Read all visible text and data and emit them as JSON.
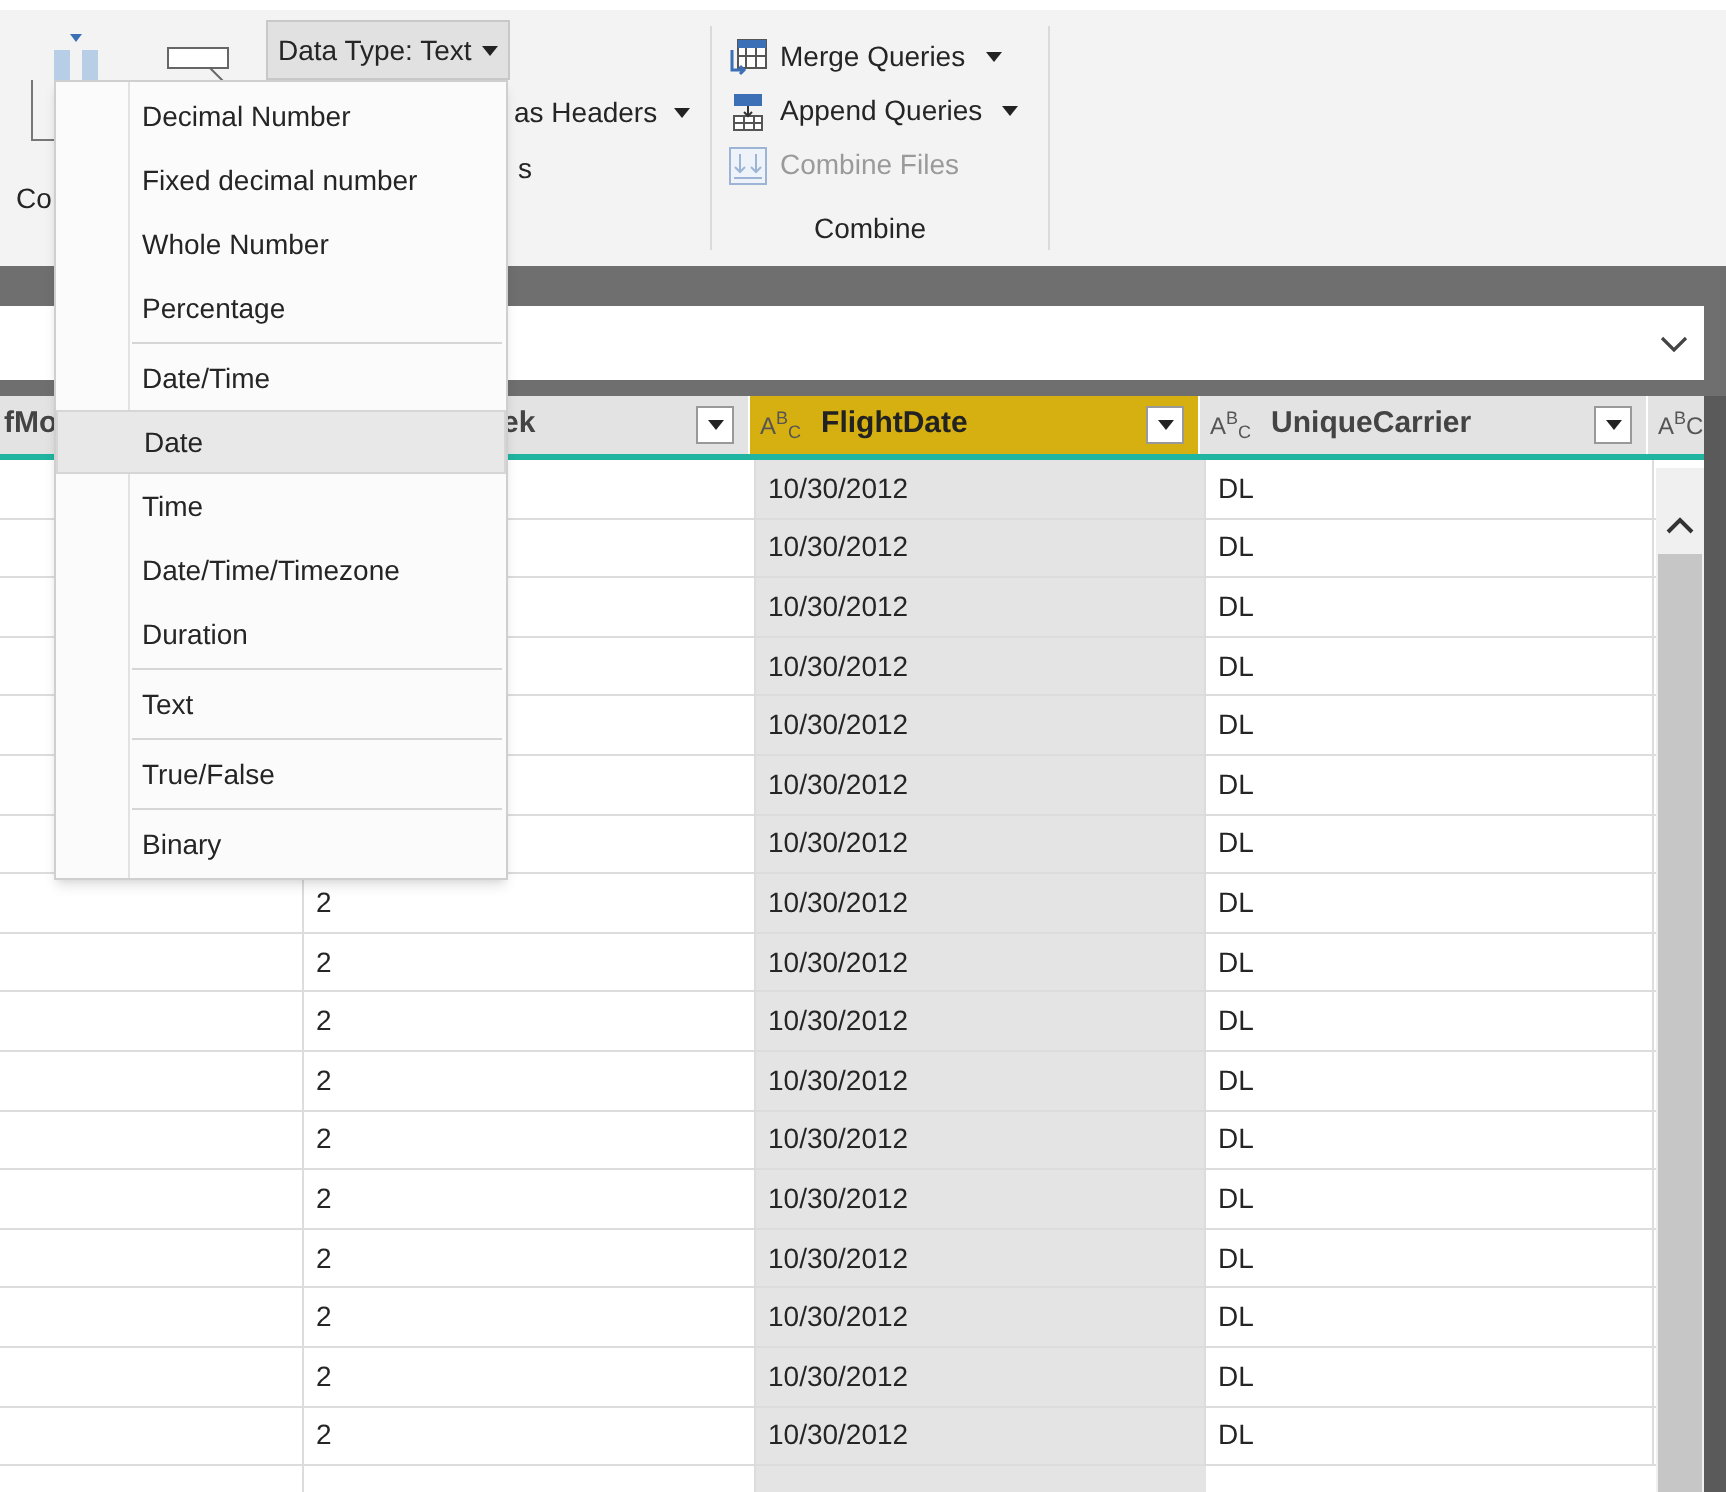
{
  "ribbon": {
    "left_label": "Co",
    "data_type_button": "Data Type: Text",
    "partial_labels": [
      "as Headers",
      "s"
    ],
    "combine": {
      "items": [
        {
          "label": "Merge Queries",
          "dropdown": true,
          "disabled": false,
          "kind": "merge"
        },
        {
          "label": "Append Queries",
          "dropdown": true,
          "disabled": false,
          "kind": "append"
        },
        {
          "label": "Combine Files",
          "dropdown": false,
          "disabled": true,
          "kind": "files"
        }
      ],
      "group_label": "Combine"
    }
  },
  "menu": [
    {
      "kind": "item",
      "label": "Decimal Number",
      "selected": false
    },
    {
      "kind": "item",
      "label": "Fixed decimal number",
      "selected": false
    },
    {
      "kind": "item",
      "label": "Whole Number",
      "selected": false
    },
    {
      "kind": "item",
      "label": "Percentage",
      "selected": false
    },
    {
      "kind": "separator"
    },
    {
      "kind": "item",
      "label": "Date/Time",
      "selected": false
    },
    {
      "kind": "item",
      "label": "Date",
      "selected": true
    },
    {
      "kind": "item",
      "label": "Time",
      "selected": false
    },
    {
      "kind": "item",
      "label": "Date/Time/Timezone",
      "selected": false
    },
    {
      "kind": "item",
      "label": "Duration",
      "selected": false
    },
    {
      "kind": "separator"
    },
    {
      "kind": "item",
      "label": "Text",
      "selected": false
    },
    {
      "kind": "separator"
    },
    {
      "kind": "item",
      "label": "True/False",
      "selected": false
    },
    {
      "kind": "separator"
    },
    {
      "kind": "item",
      "label": "Binary",
      "selected": false
    }
  ],
  "table": {
    "columns": [
      {
        "name": "fMo",
        "selected": false
      },
      {
        "name": "ek",
        "selected": false,
        "filter": true
      },
      {
        "name": "FlightDate",
        "type_icon": "A$^{B}$$_{C}$",
        "selected": true,
        "filter": true
      },
      {
        "name": "UniqueCarrier",
        "type_icon": "A$^{B}$$_{C}$",
        "selected": false,
        "filter": true
      },
      {
        "type_icon": "A$^{B}$C",
        "selected": false
      }
    ],
    "rows": [
      {
        "column_3": "10/30/2012",
        "column_4": "DL"
      },
      {
        "column_3": "10/30/2012",
        "column_4": "DL"
      },
      {
        "column_3": "10/30/2012",
        "column_4": "DL"
      },
      {
        "column_3": "10/30/2012",
        "column_4": "DL"
      },
      {
        "column_3": "10/30/2012",
        "column_4": "DL"
      },
      {
        "column_3": "10/30/2012",
        "column_4": "DL"
      },
      {
        "column_3": "10/30/2012",
        "column_4": "DL"
      },
      {
        "column_2": "2",
        "column_3": "10/30/2012",
        "column_4": "DL"
      },
      {
        "column_2": "2",
        "column_3": "10/30/2012",
        "column_4": "DL"
      },
      {
        "column_2": "2",
        "column_3": "10/30/2012",
        "column_4": "DL"
      },
      {
        "column_2": "2",
        "column_3": "10/30/2012",
        "column_4": "DL"
      },
      {
        "column_2": "2",
        "column_3": "10/30/2012",
        "column_4": "DL"
      },
      {
        "column_2": "2",
        "column_3": "10/30/2012",
        "column_4": "DL"
      },
      {
        "column_2": "2",
        "column_3": "10/30/2012",
        "column_4": "DL"
      },
      {
        "column_2": "2",
        "column_3": "10/30/2012",
        "column_4": "DL"
      },
      {
        "column_2": "2",
        "column_3": "10/30/2012",
        "column_4": "DL"
      },
      {
        "column_2": "2",
        "column_3": "10/30/2012",
        "column_4": "DL"
      }
    ]
  }
}
